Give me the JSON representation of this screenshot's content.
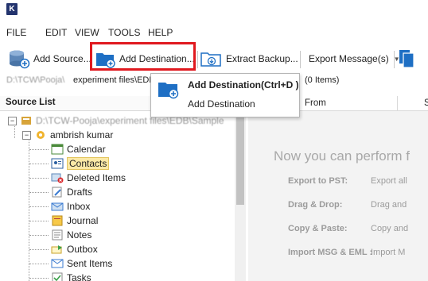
{
  "menu": [
    "FILE",
    "EDIT",
    "VIEW",
    "TOOLS",
    "HELP"
  ],
  "toolbar": {
    "add_source": "Add Source...",
    "add_destination": "Add Destination...",
    "extract_backup": "Extract Backup...",
    "export_message": "Export Message(s)"
  },
  "pathbar": {
    "path": "experiment files\\EDB",
    "count": "(0 Items)"
  },
  "dropdown": {
    "item1": "Add Destination(Ctrl+D )",
    "item2": "Add Destination"
  },
  "source_list": {
    "title": "Source List",
    "user": "ambrish kumar",
    "folders": [
      "Calendar",
      "Contacts",
      "Deleted Items",
      "Drafts",
      "Inbox",
      "Journal",
      "Notes",
      "Outbox",
      "Sent Items",
      "Tasks"
    ]
  },
  "list_header": {
    "from": "From"
  },
  "right_pane": {
    "headline": "Now you can perform f",
    "ops": [
      {
        "label": "Export to PST:",
        "desc": "Export all"
      },
      {
        "label": "Drag & Drop:",
        "desc": "Drag and"
      },
      {
        "label": "Copy & Paste:",
        "desc": "Copy and"
      },
      {
        "label": "Import MSG & EML :",
        "desc": "Import M"
      }
    ]
  },
  "colors": {
    "highlight": "#e0191f",
    "accent": "#1e6fc4",
    "selected_bg": "#fbe9a6"
  }
}
